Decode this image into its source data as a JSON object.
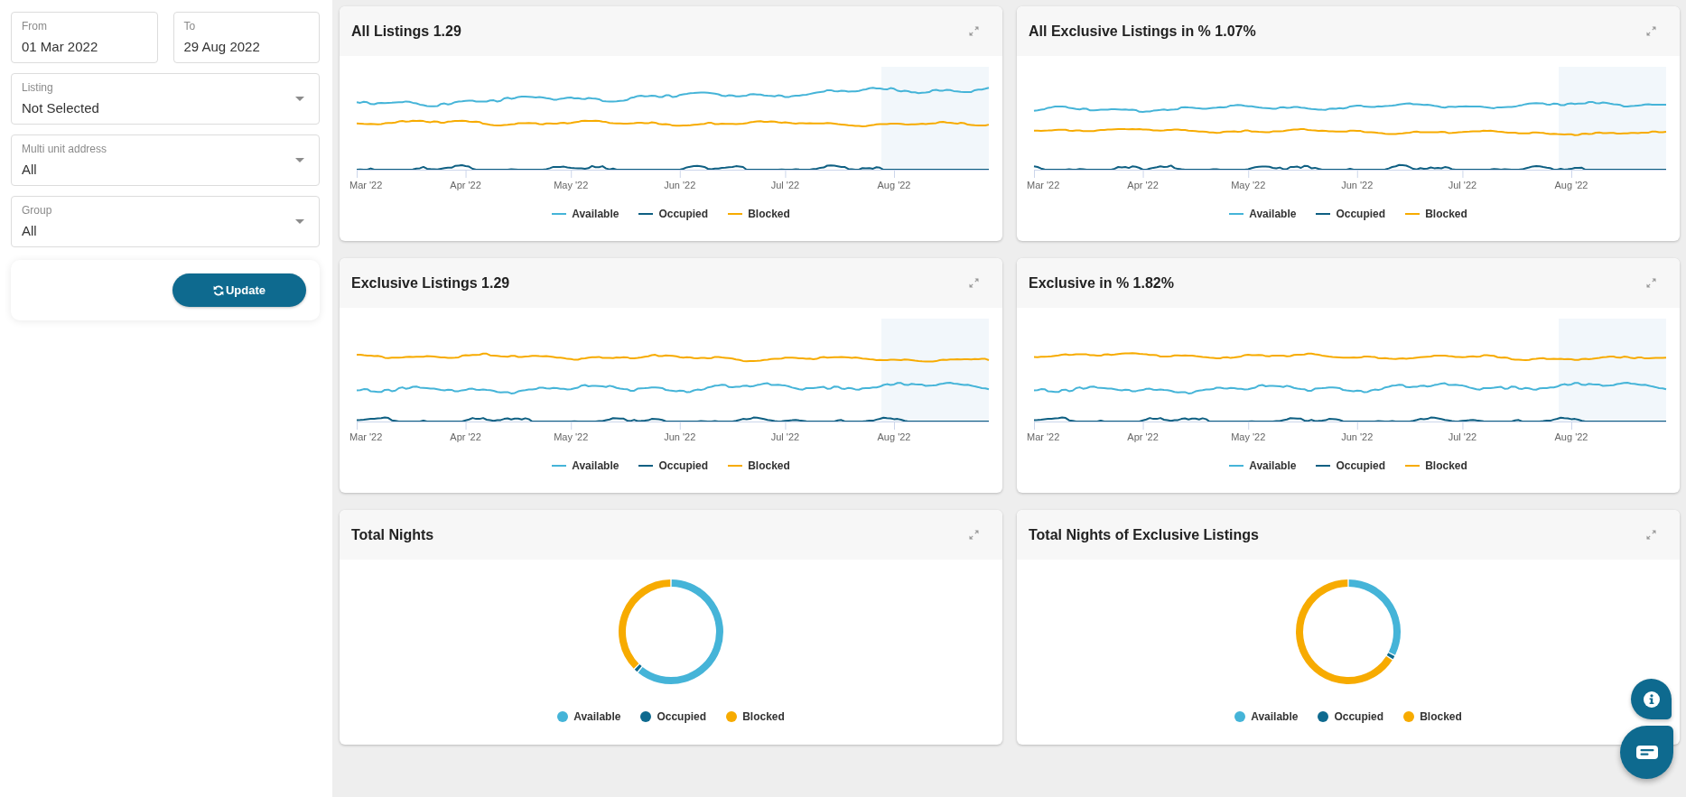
{
  "filters": {
    "dates": [
      {
        "label": "From",
        "value": "01 Mar 2022"
      },
      {
        "label": "To",
        "value": "29 Aug 2022"
      }
    ],
    "selects": [
      {
        "label": "Listing",
        "value": "Not Selected"
      },
      {
        "label": "Multi unit address",
        "value": "All"
      },
      {
        "label": "Group",
        "value": "All"
      }
    ],
    "update_button": "Update"
  },
  "charts": [
    {
      "kind": "line",
      "title": "All Listings 1.29",
      "x_labels": [
        "Mar '22",
        "Apr '22",
        "May '22",
        "Jun '22",
        "Jul '22",
        "Aug '22"
      ],
      "legend": [
        {
          "label": "Available",
          "color": "#45b4d8"
        },
        {
          "label": "Occupied",
          "color": "#0e5f82"
        },
        {
          "label": "Blocked",
          "color": "#f7ab00"
        }
      ]
    },
    {
      "kind": "line",
      "title": "All Exclusive Listings in % 1.07%",
      "x_labels": [
        "Mar '22",
        "Apr '22",
        "May '22",
        "Jun '22",
        "Jul '22",
        "Aug '22"
      ],
      "legend": [
        {
          "label": "Available",
          "color": "#45b4d8"
        },
        {
          "label": "Occupied",
          "color": "#0e5f82"
        },
        {
          "label": "Blocked",
          "color": "#f7ab00"
        }
      ]
    },
    {
      "kind": "line",
      "title": "Exclusive Listings 1.29",
      "x_labels": [
        "Mar '22",
        "Apr '22",
        "May '22",
        "Jun '22",
        "Jul '22",
        "Aug '22"
      ],
      "legend": [
        {
          "label": "Available",
          "color": "#45b4d8"
        },
        {
          "label": "Occupied",
          "color": "#0e5f82"
        },
        {
          "label": "Blocked",
          "color": "#f7ab00"
        }
      ]
    },
    {
      "kind": "line",
      "title": "Exclusive in % 1.82%",
      "x_labels": [
        "Mar '22",
        "Apr '22",
        "May '22",
        "Jun '22",
        "Jul '22",
        "Aug '22"
      ],
      "legend": [
        {
          "label": "Available",
          "color": "#45b4d8"
        },
        {
          "label": "Occupied",
          "color": "#0e5f82"
        },
        {
          "label": "Blocked",
          "color": "#f7ab00"
        }
      ]
    },
    {
      "kind": "donut",
      "title": "Total Nights",
      "legend": [
        {
          "label": "Available",
          "color": "#45b4d8"
        },
        {
          "label": "Occupied",
          "color": "#0e6a8f"
        },
        {
          "label": "Blocked",
          "color": "#f7ab00"
        }
      ]
    },
    {
      "kind": "donut",
      "title": "Total Nights of Exclusive Listings",
      "legend": [
        {
          "label": "Available",
          "color": "#45b4d8"
        },
        {
          "label": "Occupied",
          "color": "#0e6a8f"
        },
        {
          "label": "Blocked",
          "color": "#f7ab00"
        }
      ]
    }
  ]
}
